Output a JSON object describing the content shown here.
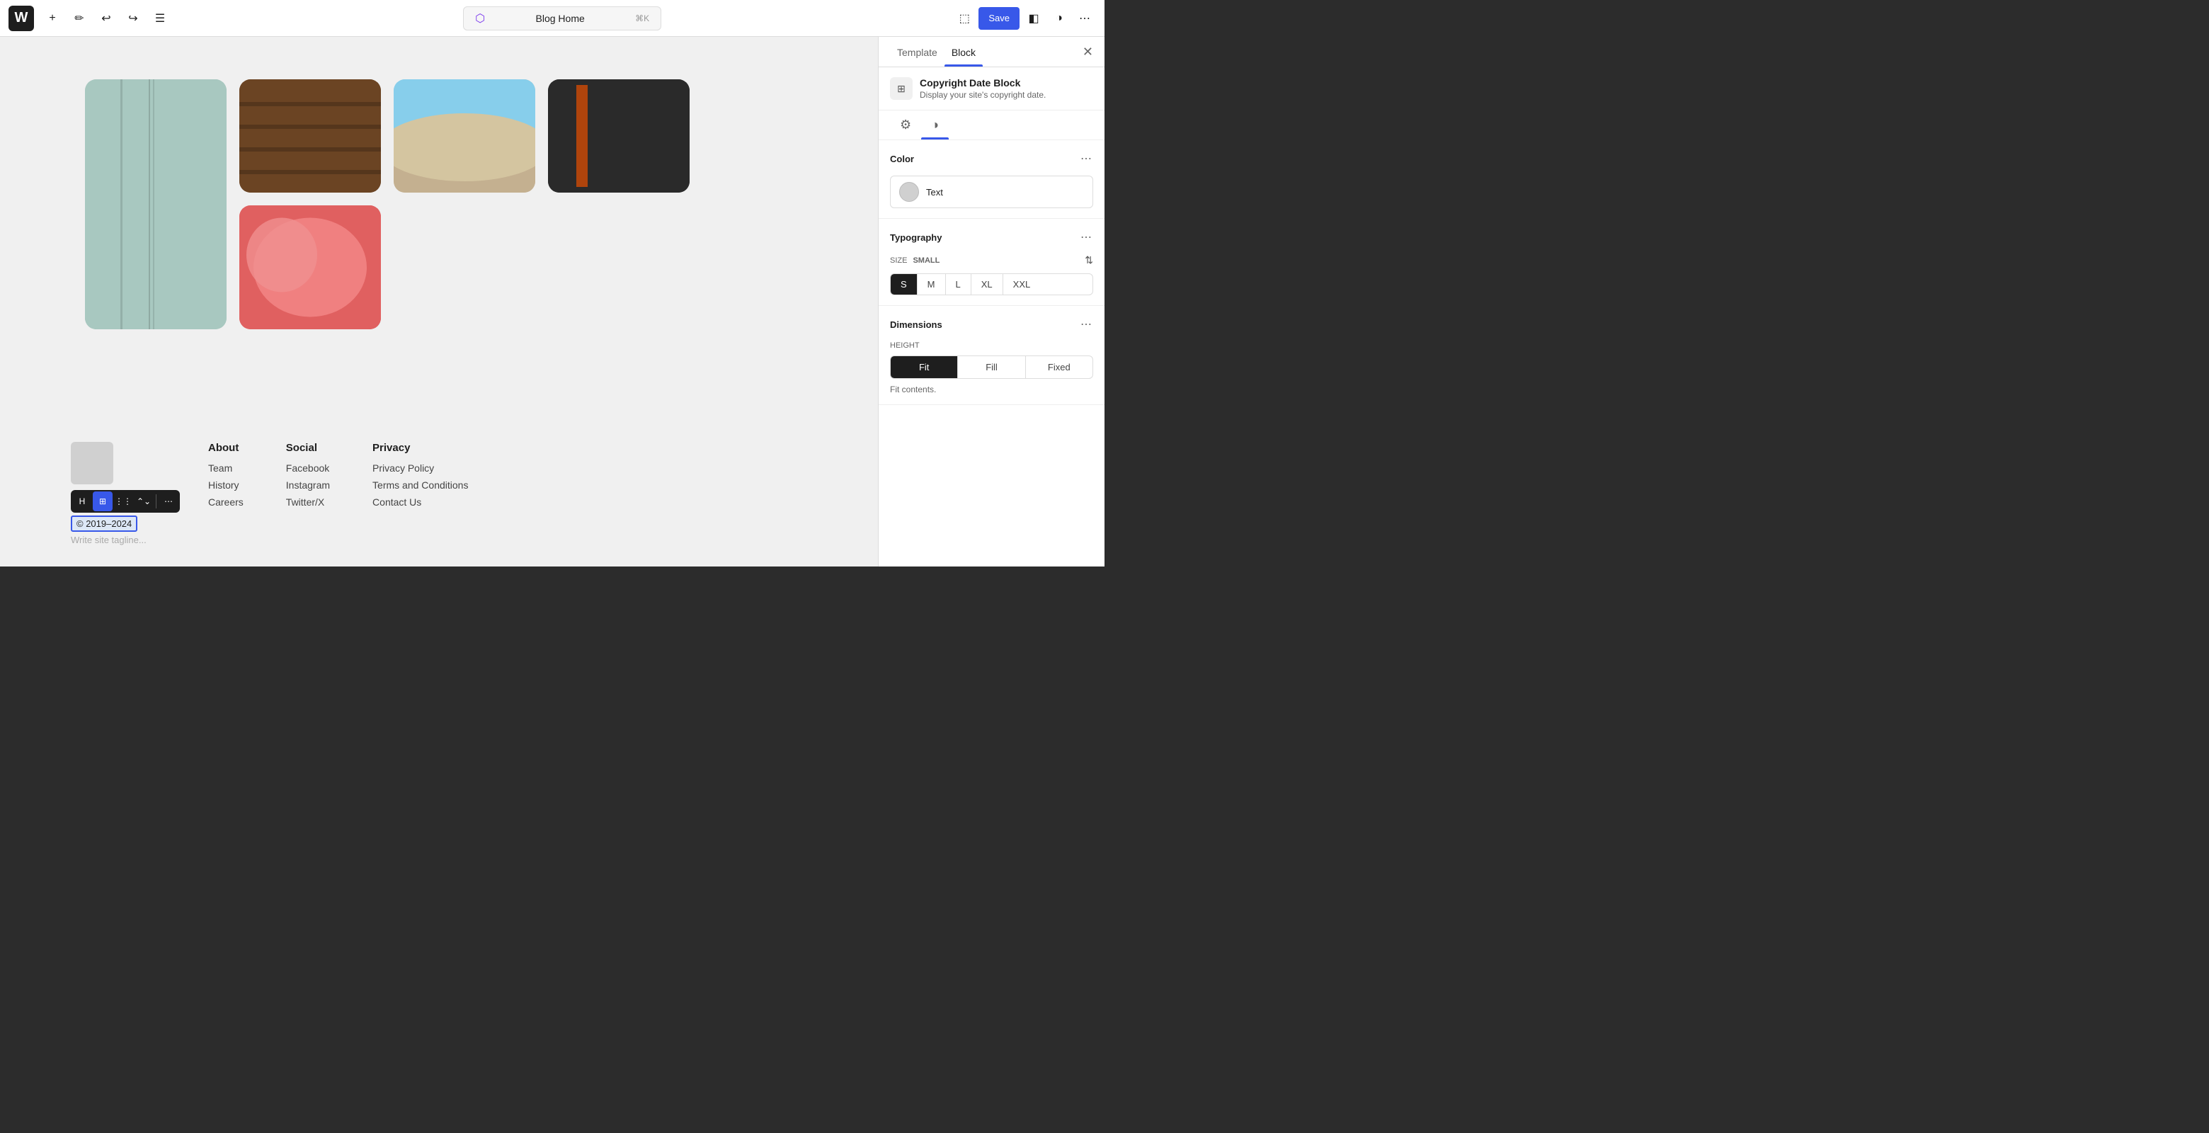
{
  "toolbar": {
    "add_label": "+",
    "undo_label": "↩",
    "redo_label": "↪",
    "list_label": "☰",
    "save_label": "Save",
    "page_title": "Blog Home",
    "page_shortcut": "⌘K",
    "view_label": "⬚",
    "contrast_label": "◑",
    "more_label": "⋯"
  },
  "panel": {
    "tab_template": "Template",
    "tab_block": "Block",
    "active_tab": "Block",
    "block_icon": "⊞",
    "block_title": "Copyright Date Block",
    "block_description": "Display your site's copyright date.",
    "sub_tab_settings": "⚙",
    "sub_tab_styles": "◑",
    "color_section": {
      "title": "Color",
      "option_label": "Text"
    },
    "typography_section": {
      "title": "Typography",
      "size_label": "SIZE",
      "size_value": "SMALL",
      "sizes": [
        "S",
        "M",
        "L",
        "XL",
        "XXL"
      ],
      "active_size": "S"
    },
    "dimensions_section": {
      "title": "Dimensions",
      "height_label": "HEIGHT",
      "heights": [
        "Fit",
        "Fill",
        "Fixed"
      ],
      "active_height": "Fit",
      "fit_note": "Fit contents."
    }
  },
  "footer": {
    "copyright_text": "© 2019–2024",
    "tagline_placeholder": "Write site tagline...",
    "about_heading": "About",
    "about_links": [
      "Team",
      "History",
      "Careers"
    ],
    "social_heading": "Social",
    "social_links": [
      "Facebook",
      "Instagram",
      "Twitter/X"
    ],
    "privacy_heading": "Privacy",
    "privacy_links": [
      "Privacy Policy",
      "Terms and Conditions",
      "Contact Us"
    ]
  },
  "block_toolbar": {
    "icon_btn": "H",
    "grid_btn": "⊞",
    "dots_btn": "⋮⋮",
    "arrows_btn": "⌃⌄",
    "more_btn": "⋯"
  }
}
